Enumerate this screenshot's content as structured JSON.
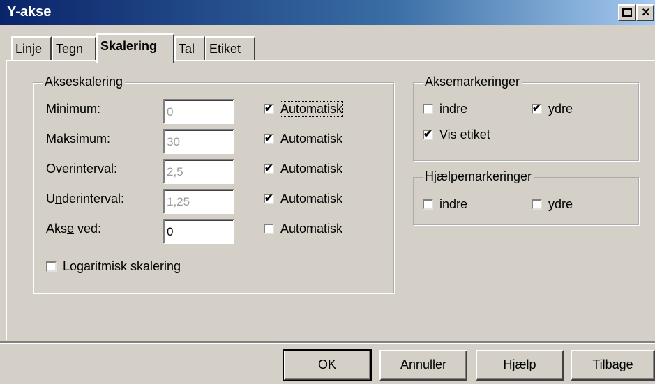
{
  "window": {
    "title": "Y-akse"
  },
  "tabs": [
    {
      "label": "Linje"
    },
    {
      "label": "Tegn"
    },
    {
      "label": "Skalering",
      "active": true
    },
    {
      "label": "Tal"
    },
    {
      "label": "Etiket"
    }
  ],
  "akseskalering": {
    "legend": "Akseskalering",
    "rows": [
      {
        "label": "Minimum:",
        "value": "0",
        "enabled": false,
        "auto_label": "Automatisk",
        "auto_checked": true
      },
      {
        "label": "Maksimum:",
        "value": "30",
        "enabled": false,
        "auto_label": "Automatisk",
        "auto_checked": true
      },
      {
        "label": "Overinterval:",
        "value": "2,5",
        "enabled": false,
        "auto_label": "Automatisk",
        "auto_checked": true
      },
      {
        "label": "Underinterval:",
        "value": "1,25",
        "enabled": false,
        "auto_label": "Automatisk",
        "auto_checked": true
      },
      {
        "label": "Akse ved:",
        "value": "0",
        "enabled": true,
        "auto_label": "Automatisk",
        "auto_checked": false
      }
    ],
    "log_label": "Logaritmisk skalering",
    "log_checked": false
  },
  "aksemarkeringer": {
    "legend": "Aksemarkeringer",
    "indre_label": "indre",
    "indre_checked": false,
    "ydre_label": "ydre",
    "ydre_checked": true,
    "vis_label": "Vis etiket",
    "vis_checked": true
  },
  "hjaelpemarkeringer": {
    "legend": "Hjælpemarkeringer",
    "indre_label": "indre",
    "indre_checked": false,
    "ydre_label": "ydre",
    "ydre_checked": false
  },
  "buttons": {
    "ok": "OK",
    "cancel": "Annuller",
    "help": "Hjælp",
    "back": "Tilbage"
  }
}
